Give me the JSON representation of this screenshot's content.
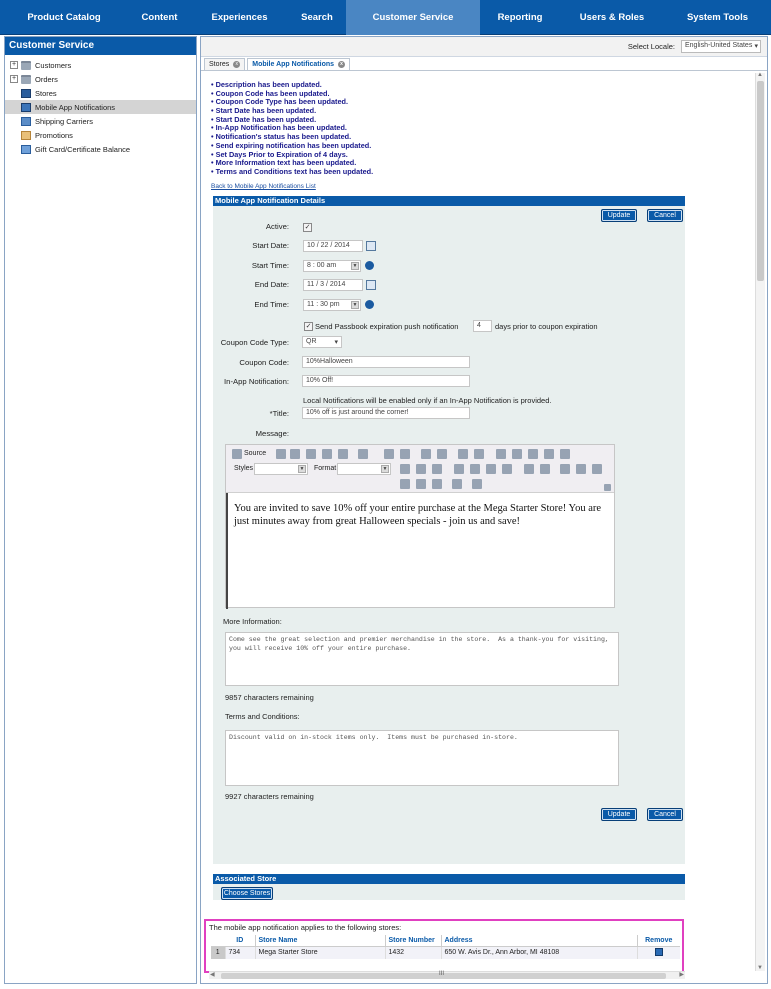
{
  "nav": [
    {
      "label": "Product Catalog"
    },
    {
      "label": "Content"
    },
    {
      "label": "Experiences"
    },
    {
      "label": "Search"
    },
    {
      "label": "Customer Service"
    },
    {
      "label": "Reporting"
    },
    {
      "label": "Users & Roles"
    },
    {
      "label": "System Tools"
    }
  ],
  "sidebar": {
    "title": "Customer Service",
    "items": [
      {
        "label": "Customers"
      },
      {
        "label": "Orders"
      },
      {
        "label": "Stores"
      },
      {
        "label": "Mobile App Notifications"
      },
      {
        "label": "Shipping Carriers"
      },
      {
        "label": "Promotions"
      },
      {
        "label": "Gift Card/Certificate Balance"
      }
    ]
  },
  "locale": {
    "label": "Select Locale:",
    "value": "English-United States"
  },
  "tabs": [
    {
      "label": "Stores"
    },
    {
      "label": "Mobile App Notifications"
    }
  ],
  "messages": [
    "Description has been updated.",
    "Coupon Code has been updated.",
    "Coupon Code Type has been updated.",
    "Start Date has been updated.",
    "Start Date has been updated.",
    "In-App Notification has been updated.",
    "Notification's status has been updated.",
    "Send expiring notification has been updated.",
    "Set Days Prior to Expiration of 4 days.",
    "More Information text has been updated.",
    "Terms and Conditions text has been updated."
  ],
  "back_link": "Back to Mobile App Notifications List",
  "details": {
    "title": "Mobile App Notification Details",
    "update": "Update",
    "cancel": "Cancel",
    "active_label": "Active:",
    "start_date_label": "Start Date:",
    "start_date": "10 / 22 /  2014",
    "start_time_label": "Start Time:",
    "start_time": "8  : 00   am",
    "end_date_label": "End Date:",
    "end_date": "11 /  3  /  2014",
    "end_time_label": "End Time:",
    "end_time": "11  : 30   pm",
    "passbook_label": "Send Passbook expiration push notification",
    "passbook_days": "4",
    "passbook_suffix": "days prior to coupon expiration",
    "coupon_type_label": "Coupon Code Type:",
    "coupon_type": "QR",
    "coupon_code_label": "Coupon Code:",
    "coupon_code": "10%Halloween",
    "inapp_label": "In-App Notification:",
    "inapp": "10% Off!",
    "local_note": "Local Notifications will be enabled only if an In-App Notification is provided.",
    "title_label": "*Title:",
    "title_value": "10% off is just around the corner!",
    "message_label": "Message:",
    "toolbar_source": "Source",
    "toolbar_styles": "Styles",
    "toolbar_format": "Format",
    "message_text": "You are invited to save 10% off your entire purchase at the Mega Starter Store!  You are just minutes away from great Halloween specials - join us and save!",
    "more_info_label": "More Information:",
    "more_info": "Come see the great selection and premier merchandise in the store.  As a thank-you for visiting, you will receive 10% off your entire purchase.",
    "more_info_remaining": "9857 characters remaining",
    "terms_label": "Terms and Conditions:",
    "terms": "Discount valid on in-stock items only.  Items must be purchased in-store.",
    "terms_remaining": "9927  characters remaining"
  },
  "assoc": {
    "title": "Associated Store",
    "choose": "Choose Stores",
    "caption": "The mobile app notification applies to the following stores:",
    "headers": {
      "id": "ID",
      "name": "Store Name",
      "number": "Store Number",
      "address": "Address",
      "remove": "Remove"
    },
    "row": {
      "num": "1",
      "id": "734",
      "name": "Mega Starter Store",
      "number": "1432",
      "address": "650 W. Avis Dr., Ann Arbor, MI 48108"
    }
  },
  "hscroll_grip": "III"
}
